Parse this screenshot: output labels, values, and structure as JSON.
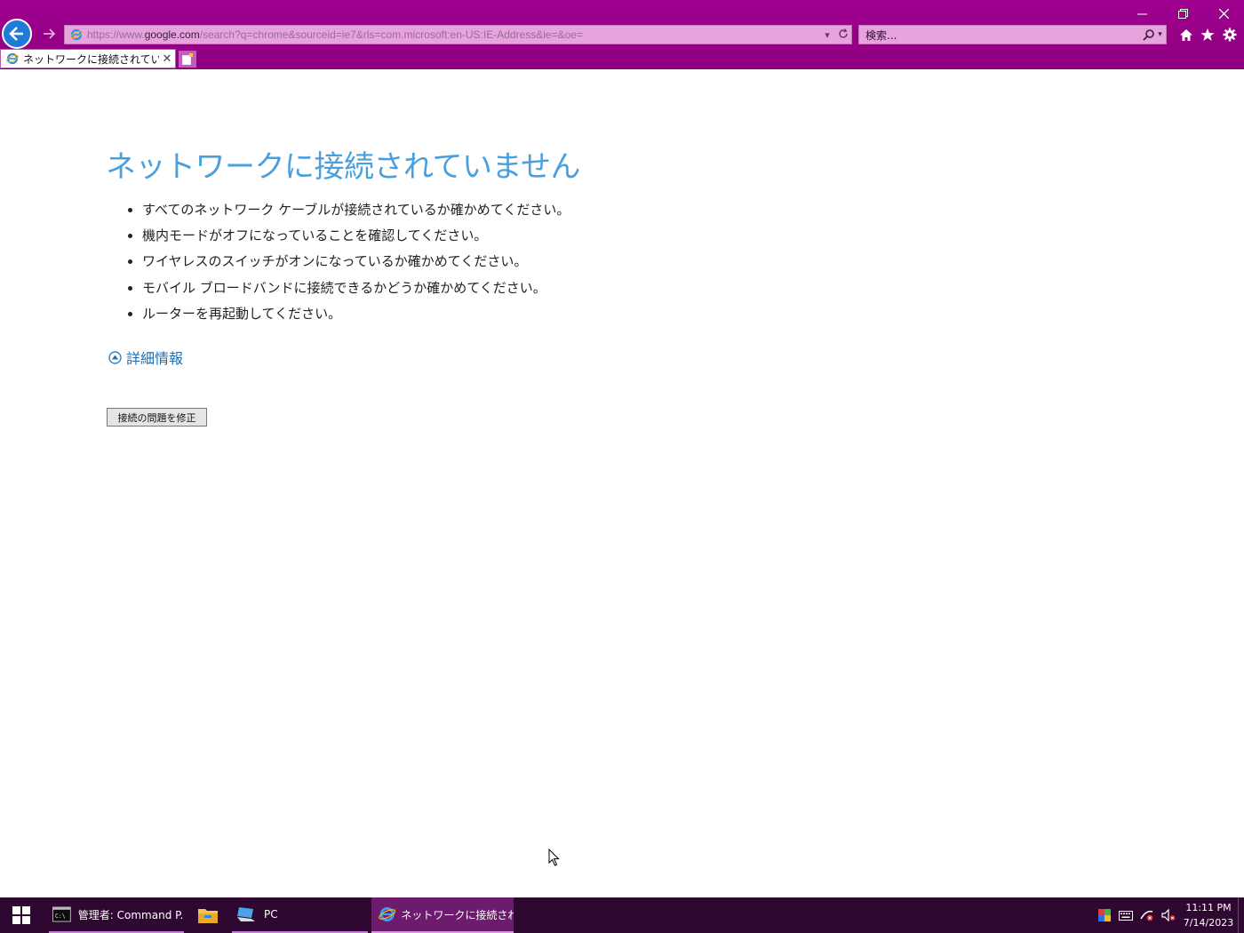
{
  "browser": {
    "url_prefix": "https://www.",
    "url_domain": "google.com",
    "url_rest": "/search?q=chrome&sourceid=ie7&rls=com.microsoft:en-US:IE-Address&ie=&oe=",
    "search_placeholder": "検索...",
    "tab_title": "ネットワークに接続されていません",
    "accent": "#9b008c"
  },
  "page": {
    "title": "ネットワークに接続されていません",
    "hints": [
      "すべてのネットワーク ケーブルが接続されているか確かめてください。",
      "機内モードがオフになっていることを確認してください。",
      "ワイヤレスのスイッチがオンになっているか確かめてください。",
      "モバイル ブロードバンドに接続できるかどうか確かめてください。",
      "ルーターを再起動してください。"
    ],
    "details_label": "詳細情報",
    "fix_button": "接続の問題を修正"
  },
  "taskbar": {
    "cmd_label": "管理者: Command P...",
    "pc_label": "PC",
    "ie_label": "ネットワークに接続され...",
    "time": "11:11 PM",
    "date": "7/14/2023"
  }
}
